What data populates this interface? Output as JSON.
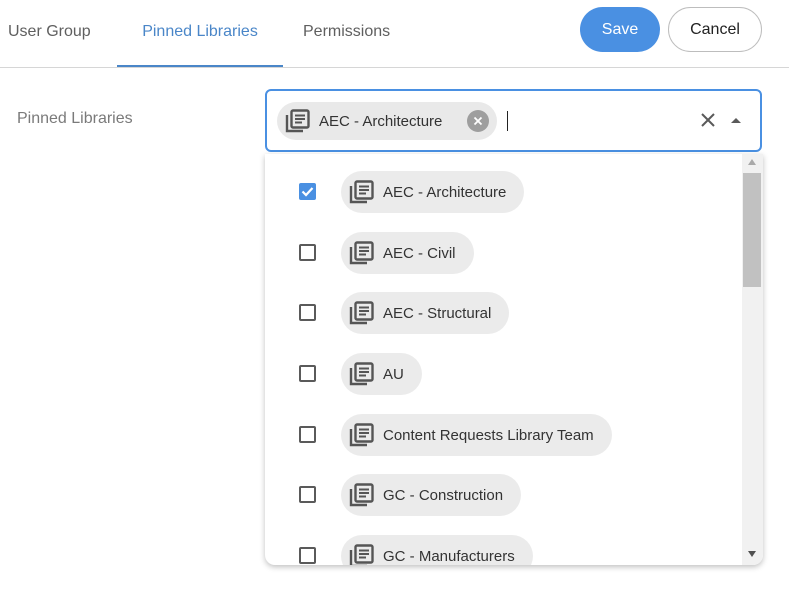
{
  "tabs": [
    {
      "label": "User Group",
      "active": false
    },
    {
      "label": "Pinned Libraries",
      "active": true
    },
    {
      "label": "Permissions",
      "active": false
    }
  ],
  "actions": {
    "save_label": "Save",
    "cancel_label": "Cancel"
  },
  "field": {
    "label": "Pinned Libraries",
    "input_value": ""
  },
  "selected": [
    {
      "label": "AEC - Architecture",
      "icon": "library-icon"
    }
  ],
  "options": [
    {
      "label": "AEC - Architecture",
      "checked": true,
      "icon": "library-icon"
    },
    {
      "label": "AEC - Civil",
      "checked": false,
      "icon": "library-icon"
    },
    {
      "label": "AEC - Structural",
      "checked": false,
      "icon": "library-icon"
    },
    {
      "label": "AU",
      "checked": false,
      "icon": "library-icon"
    },
    {
      "label": "Content Requests Library Team",
      "checked": false,
      "icon": "library-icon"
    },
    {
      "label": "GC - Construction",
      "checked": false,
      "icon": "library-icon"
    },
    {
      "label": "GC - Manufacturers",
      "checked": false,
      "icon": "library-icon"
    }
  ],
  "colors": {
    "accent": "#4a90e2",
    "tab_active": "#4a86c8",
    "chip_bg": "#ebebeb"
  }
}
